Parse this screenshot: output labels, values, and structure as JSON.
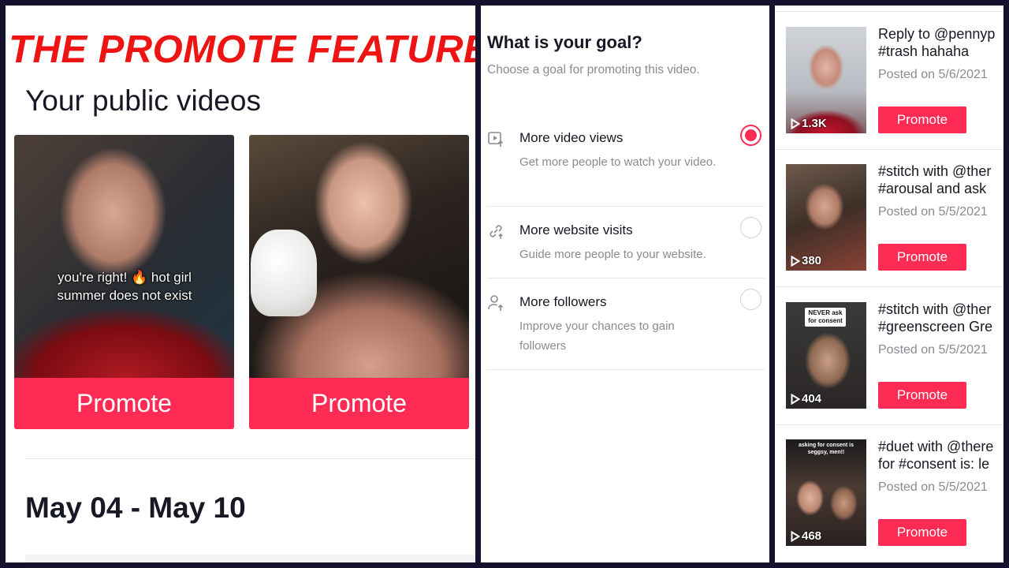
{
  "banner": "THE PROMOTE FEATURE",
  "left_panel": {
    "title": "Your public videos",
    "videos": [
      {
        "overlay_text": "you're right! 🔥 hot girl summer does not exist",
        "button": "Promote"
      },
      {
        "overlay_text": "",
        "button": "Promote"
      }
    ],
    "date_range": "May 04 - May 10"
  },
  "goal_panel": {
    "title": "What is your goal?",
    "subtitle": "Choose a goal for promoting this video.",
    "options": [
      {
        "label": "More video views",
        "desc": "Get more people to watch your video.",
        "icon": "video-play-up-icon",
        "selected": true
      },
      {
        "label": "More website visits",
        "desc": "Guide more people to your website.",
        "icon": "link-up-icon",
        "selected": false
      },
      {
        "label": "More followers",
        "desc": "Improve your chances to gain followers",
        "icon": "person-up-icon",
        "selected": false
      }
    ]
  },
  "video_list": {
    "items": [
      {
        "title": "Reply to @pennyp #trash hahaha",
        "posted": "Posted on 5/6/2021",
        "views": "1.3K",
        "button": "Promote",
        "thumb_text": ""
      },
      {
        "title": "#stitch with @ther #arousal and  ask",
        "posted": "Posted on 5/5/2021",
        "views": "380",
        "button": "Promote",
        "thumb_text": ""
      },
      {
        "title": "#stitch with @ther #greenscreen Gre",
        "posted": "Posted on 5/5/2021",
        "views": "404",
        "button": "Promote",
        "thumb_text": "NEVER ask for consent"
      },
      {
        "title": "#duet with @there for #consent is: le",
        "posted": "Posted on 5/5/2021",
        "views": "468",
        "button": "Promote",
        "thumb_text": "asking for consent is seggsy, men!!"
      }
    ]
  },
  "colors": {
    "accent": "#fe2c55",
    "banner_red": "#ef1414",
    "frame": "#15122e"
  }
}
